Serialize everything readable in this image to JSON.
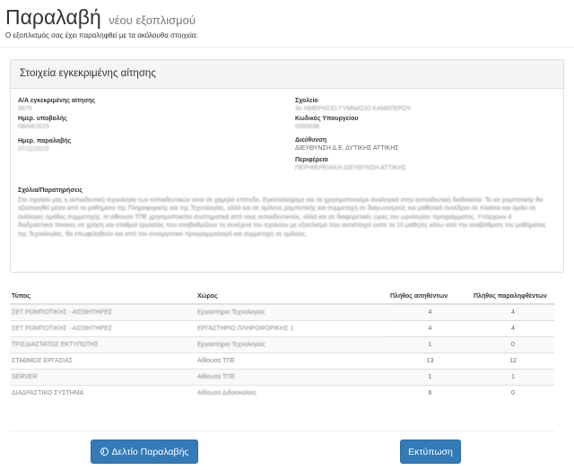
{
  "header": {
    "title": "Παραλαβή",
    "subtitle": "νέου εξοπλισμού",
    "intro": "Ο εξοπλισμός σας έχει παραληφθεί με τα ακόλουθα στοιχεία:"
  },
  "panel": {
    "heading": "Στοιχεία εγκεκριμένης αίτησης",
    "left": [
      {
        "label": "Α/Α εγκεκριμένης αίτησης",
        "value": "5675"
      },
      {
        "label": "Ημερ. υποβολής",
        "value": "08/04/2015"
      },
      {
        "label": "Ημερ. παραλαβής",
        "value": "07/11/2015"
      }
    ],
    "right": [
      {
        "label": "Σχολείο",
        "value": "3ο ΗΜΕΡΗΣΙΟ ΓΥΜΝΑΣΙΟ ΚΑΜΑΤΕΡΟΥ"
      },
      {
        "label": "Κωδικός Υπουργείου",
        "value": "0550036"
      },
      {
        "label": "Διεύθυνση",
        "value": "ΔΙΕΥΘΥΝΣΗ Δ.Ε. ΔΥΤΙΚΗΣ ΑΤΤΙΚΗΣ"
      },
      {
        "label": "Περιφέρεια",
        "value": "ΠΕΡΙΦΕΡΕΙΑΚΗ ΔΙΕΥΘΥΝΣΗ ΑΤΤΙΚΗΣ"
      }
    ],
    "comments_label": "Σχόλια/Παρατηρήσεις",
    "comments_value": "Στο σχολείο μας η εκπαιδευτική τεχνολογία των εκπαιδευτικών είναι σε χαμηλό επίπεδο. Εγκαταλείψαμε και τα χρησιμοποιούμε αναλογικά στην εκπαιδευτική διαδικασία. Το κιτ ρομποτικής θα αξιοποιηθεί μέσα από τα μαθήματα της Πληροφορικής και της Τεχνολογίας, αλλά και σε ομίλους ρομποτικής και συμμετοχή σε διαγωνισμούς και μαθητικά συνέδρια σε πλαίσιο και όμιλο σε ανάλογες ομάδες συμμετοχής. Η αίθουσα ΤΠΕ χρησιμοποιείται συστηματικά από τους εκπαιδευτικούς, αλλά και σε διαφορετικές ώρες του ωρολογίου προγράμματος. Υπάρχουν 4 διαδραστικοί πίνακες σε χρήση και σταθμοί εργασίας που αναβαθμίζουν τη συνέχεια του σχολείου με εξοπλισμό που αντιστοιχεί ώστε τα 10 μαθητές κάτω από την αναβάθμιση του μαθήματος της Τεχνολογίας, θα επωφεληθούν και από τον συνεργατικό προγραμματισμό και συμμετοχή σε ομίλους."
  },
  "table": {
    "headers": [
      "Τύπος",
      "Χώρος",
      "Πλήθος αιτηθέντων",
      "Πλήθος παραληφθέντων"
    ],
    "rows": [
      {
        "type": "ΣΕΤ ΡΟΜΠΟΤΙΚΗΣ - ΑΙΣΘΗΤΗΡΕΣ",
        "place": "Εργαστήριο Τεχνολογίας",
        "requested": "4",
        "received": "4"
      },
      {
        "type": "ΣΕΤ ΡΟΜΠΟΤΙΚΗΣ - ΑΙΣΘΗΤΗΡΕΣ",
        "place": "ΕΡΓΑΣΤΗΡΙΟ ΠΛΗΡΟΦΟΡΙΚΗΣ 1",
        "requested": "4",
        "received": "4"
      },
      {
        "type": "ΤΡΙΣΔΙΑΣΤΑΤΟΣ ΕΚΤΥΠΩΤΗΣ",
        "place": "Εργαστήριο Τεχνολογίας",
        "requested": "1",
        "received": "0"
      },
      {
        "type": "ΣΤΑΘΜΟΣ ΕΡΓΑΣΙΑΣ",
        "place": "Αίθουσα ΤΠΕ",
        "requested": "13",
        "received": "12"
      },
      {
        "type": "SERVER",
        "place": "Αίθουσα ΤΠΕ",
        "requested": "1",
        "received": "1"
      },
      {
        "type": "ΔΙΑΔΡΑΣΤΙΚΟ ΣΥΣΤΗΜΑ",
        "place": "Αίθουσα Διδασκαλίας",
        "requested": "6",
        "received": "0"
      }
    ]
  },
  "buttons": {
    "receipt_label": "Δελτίο Παραλαβής",
    "receipt_icon": "download-circle-icon",
    "print_label": "Εκτύπωση"
  },
  "colors": {
    "primary": "#337ab7",
    "panel_heading_bg": "#f5f5f5",
    "border": "#dddddd"
  }
}
